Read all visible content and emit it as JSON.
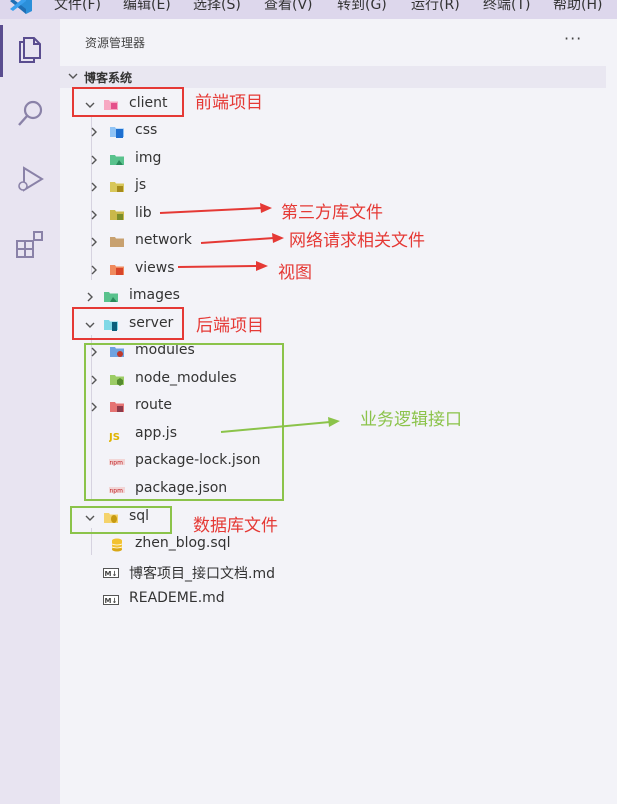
{
  "menubar": {
    "items": [
      "文件(F)",
      "编辑(E)",
      "选择(S)",
      "查看(V)",
      "转到(G)",
      "运行(R)",
      "终端(T)",
      "帮助(H)"
    ]
  },
  "explorer": {
    "title": "资源管理器",
    "more": "···",
    "root": "博客系统",
    "tree": [
      {
        "name": "client",
        "icon": "folder-client-icon"
      },
      {
        "name": "css",
        "icon": "folder-css-icon"
      },
      {
        "name": "img",
        "icon": "folder-images-icon"
      },
      {
        "name": "js",
        "icon": "folder-js-icon"
      },
      {
        "name": "lib",
        "icon": "folder-lib-icon"
      },
      {
        "name": "network",
        "icon": "folder-icon"
      },
      {
        "name": "views",
        "icon": "folder-views-icon"
      },
      {
        "name": "images",
        "icon": "folder-images-icon"
      },
      {
        "name": "server",
        "icon": "folder-server-icon"
      },
      {
        "name": "modules",
        "icon": "folder-modules-icon"
      },
      {
        "name": "node_modules",
        "icon": "folder-node-icon"
      },
      {
        "name": "route",
        "icon": "folder-route-icon"
      },
      {
        "name": "app.js",
        "icon": "js-file-icon"
      },
      {
        "name": "package-lock.json",
        "icon": "npm-file-icon"
      },
      {
        "name": "package.json",
        "icon": "npm-file-icon"
      },
      {
        "name": "sql",
        "icon": "folder-sql-icon"
      },
      {
        "name": "zhen_blog.sql",
        "icon": "database-file-icon"
      },
      {
        "name": "博客项目_接口文档.md",
        "icon": "markdown-file-icon"
      },
      {
        "name": "READEME.md",
        "icon": "markdown-file-icon"
      }
    ]
  },
  "annotations": {
    "frontend": "前端项目",
    "third_party": "第三方库文件",
    "network": "网络请求相关文件",
    "views": "视图",
    "backend": "后端项目",
    "business": "业务逻辑接口",
    "database": "数据库文件"
  },
  "colors": {
    "annotation_red": "#e53935",
    "annotation_green": "#8bc34a"
  }
}
